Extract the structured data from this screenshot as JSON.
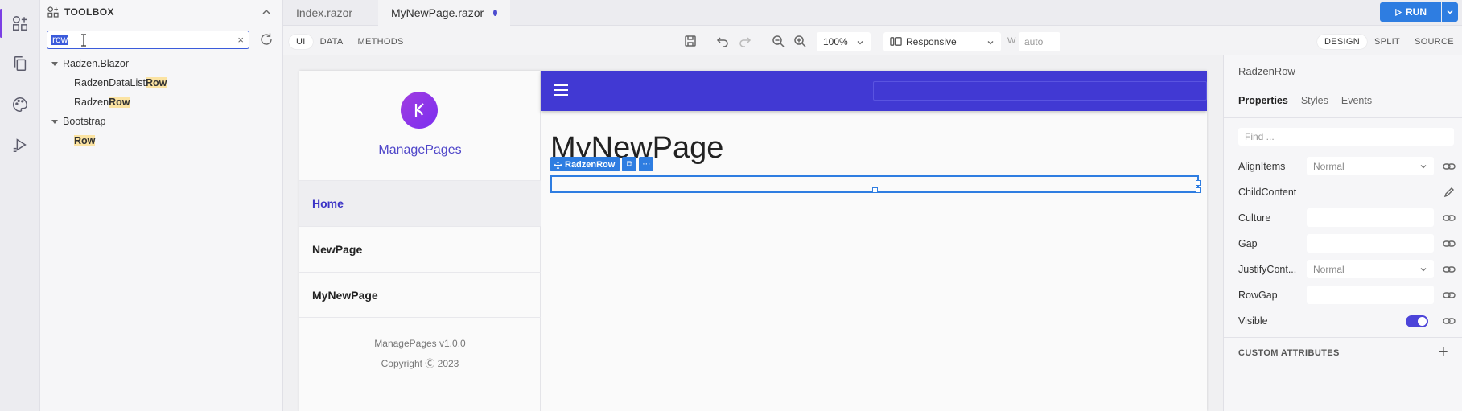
{
  "toolbox": {
    "title": "TOOLBOX",
    "search_value": "row",
    "tree": [
      {
        "group": "Radzen.Blazor",
        "items": [
          {
            "prefix": "RadzenDataList",
            "match": "Row"
          },
          {
            "prefix": "Radzen",
            "match": "Row"
          }
        ]
      },
      {
        "group": "Bootstrap",
        "items": [
          {
            "prefix": "",
            "match": "Row"
          }
        ]
      }
    ]
  },
  "tabs": [
    {
      "label": "Index.razor"
    },
    {
      "label": "MyNewPage.razor",
      "modified": true
    }
  ],
  "run": {
    "label": "RUN"
  },
  "toolbar": {
    "modes": [
      "UI",
      "DATA",
      "METHODS"
    ],
    "zoom": "100%",
    "device": "Responsive",
    "width_label": "W",
    "width_value": "auto",
    "views": [
      "DESIGN",
      "SPLIT",
      "SOURCE"
    ]
  },
  "preview": {
    "brand": "ManagePages",
    "nav": [
      "Home",
      "NewPage",
      "MyNewPage"
    ],
    "version": "ManagePages v1.0.0",
    "copyright": "Copyright Ⓒ 2023",
    "heading": "MyNewPage",
    "selected_tag": "RadzenRow"
  },
  "properties": {
    "component": "RadzenRow",
    "tabs": [
      "Properties",
      "Styles",
      "Events"
    ],
    "find_placeholder": "Find ...",
    "rows": [
      {
        "name": "AlignItems",
        "value": "Normal",
        "kind": "select"
      },
      {
        "name": "ChildContent",
        "value": "",
        "kind": "edit"
      },
      {
        "name": "Culture",
        "value": "",
        "kind": "input"
      },
      {
        "name": "Gap",
        "value": "",
        "kind": "input"
      },
      {
        "name": "JustifyCont...",
        "value": "Normal",
        "kind": "select"
      },
      {
        "name": "RowGap",
        "value": "",
        "kind": "input"
      },
      {
        "name": "Visible",
        "value": "",
        "kind": "toggle"
      }
    ],
    "custom_attributes": "CUSTOM ATTRIBUTES"
  },
  "colors": {
    "accent": "#4139d3",
    "run": "#2e7de1",
    "highlight": "#fbe3a2"
  }
}
